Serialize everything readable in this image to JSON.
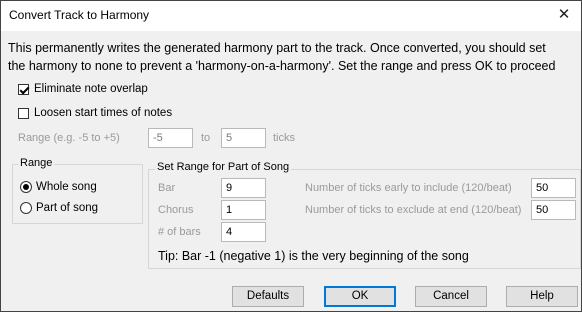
{
  "window": {
    "title": "Convert Track to Harmony",
    "close_glyph": "✕"
  },
  "message": {
    "line1": "This permanently writes the generated harmony part to the track. Once converted, you should set",
    "line2": "the harmony to none to prevent a 'harmony-on-a-harmony'. Set the range and press OK to proceed"
  },
  "options": {
    "eliminate_overlap": {
      "label": "Eliminate note overlap",
      "checked": true
    },
    "loosen_start": {
      "label": "Loosen start times of notes",
      "checked": false
    }
  },
  "range_ticks": {
    "label": "Range (e.g. -5 to +5)",
    "from": "-5",
    "to_label": "to",
    "to": "5",
    "units": "ticks"
  },
  "range_group": {
    "title": "Range",
    "whole_song": {
      "label": "Whole song",
      "selected": true
    },
    "part_of_song": {
      "label": "Part of song",
      "selected": false
    }
  },
  "set_range": {
    "title": "Set Range for Part of Song",
    "bar_label": "Bar",
    "bar_value": "9",
    "chorus_label": "Chorus",
    "chorus_value": "1",
    "bars_label": "# of bars",
    "bars_value": "4",
    "ticks_early_label": "Number of ticks early to include (120/beat)",
    "ticks_early_value": "50",
    "ticks_exclude_label": "Number of ticks to exclude at end (120/beat)",
    "ticks_exclude_value": "50",
    "tip": "Tip: Bar -1 (negative 1) is the very beginning of the song"
  },
  "buttons": {
    "defaults": "Defaults",
    "ok": "OK",
    "cancel": "Cancel",
    "help": "Help"
  }
}
